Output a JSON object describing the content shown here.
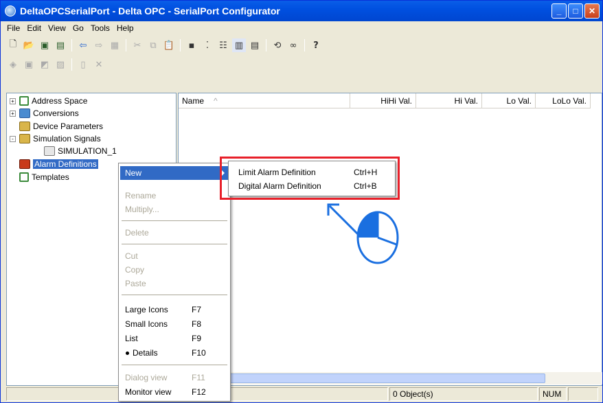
{
  "window": {
    "title": "DeltaOPCSerialPort - Delta OPC - SerialPort Configurator"
  },
  "menubar": [
    "File",
    "Edit",
    "View",
    "Go",
    "Tools",
    "Help"
  ],
  "tree": [
    {
      "label": "Address Space",
      "icon": "tree-icon",
      "expander": "+"
    },
    {
      "label": "Conversions",
      "icon": "conversion-icon",
      "expander": "+"
    },
    {
      "label": "Device Parameters",
      "icon": "device-icon",
      "expander": ""
    },
    {
      "label": "Simulation Signals",
      "icon": "simulation-icon",
      "expander": "-"
    },
    {
      "label": "SIMULATION_1",
      "icon": "signal-icon",
      "expander": ""
    },
    {
      "label": "Alarm Definitions",
      "icon": "alarm-icon",
      "expander": ""
    },
    {
      "label": "Templates",
      "icon": "tree-icon",
      "expander": ""
    }
  ],
  "list": {
    "columns": [
      "Name",
      "HiHi Val.",
      "Hi Val.",
      "Lo Val.",
      "LoLo Val."
    ]
  },
  "context_menu": {
    "new": "New",
    "rename": "Rename",
    "multiply": "Multiply...",
    "delete": "Delete",
    "cut": "Cut",
    "copy": "Copy",
    "paste": "Paste",
    "large_icons": "Large Icons",
    "large_icons_sc": "F7",
    "small_icons": "Small Icons",
    "small_icons_sc": "F8",
    "list": "List",
    "list_sc": "F9",
    "details": "Details",
    "details_sc": "F10",
    "dialog_view": "Dialog view",
    "dialog_view_sc": "F11",
    "monitor_view": "Monitor view",
    "monitor_view_sc": "F12"
  },
  "submenu": {
    "limit": "Limit Alarm Definition",
    "limit_sc": "Ctrl+H",
    "digital": "Digital Alarm Definition",
    "digital_sc": "Ctrl+B"
  },
  "status": {
    "objects": "0 Object(s)",
    "num": "NUM"
  },
  "colors": {
    "highlight": "#316ac5",
    "annotation_red": "#e8202a",
    "annotation_blue": "#1a6fe0"
  }
}
